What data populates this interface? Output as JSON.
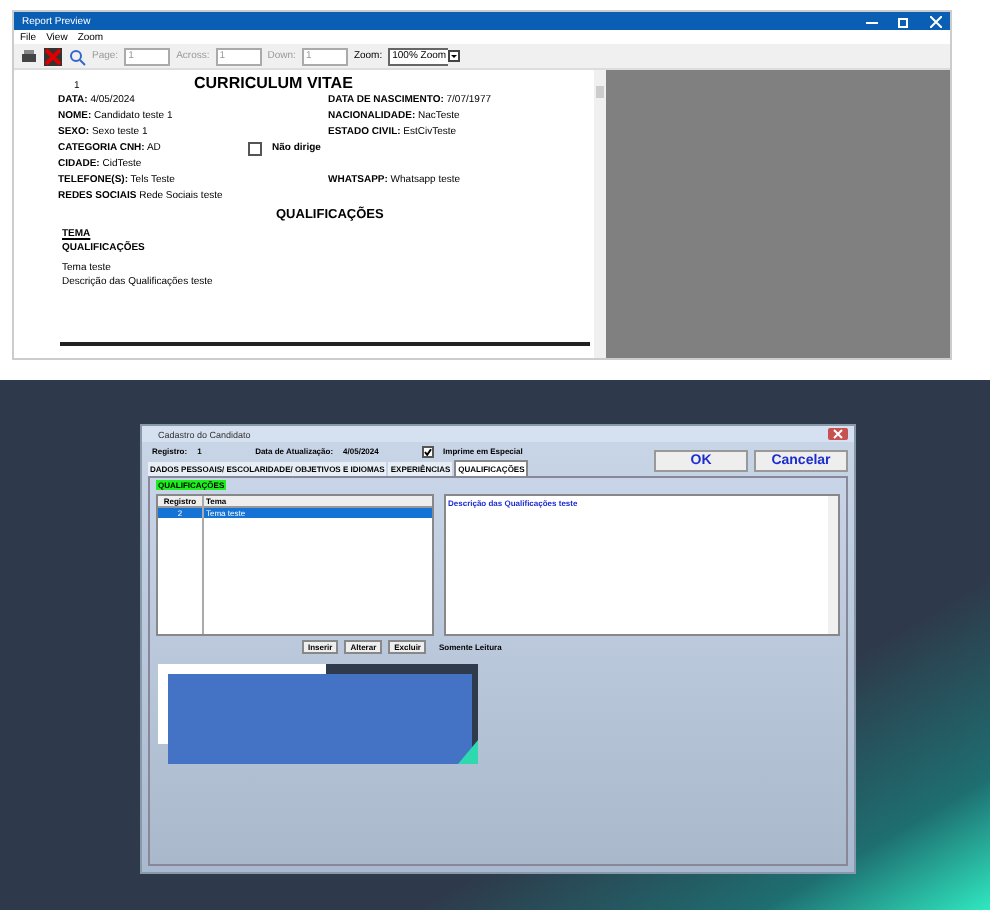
{
  "preview": {
    "title": "Report Preview",
    "menu": [
      "File",
      "View",
      "Zoom"
    ],
    "toolbar": {
      "page_label": "Page:",
      "page": "1",
      "across_label": "Across:",
      "across": "1",
      "down_label": "Down:",
      "down": "1",
      "zoom_label": "Zoom:",
      "zoom": "100% Zoom"
    },
    "report": {
      "page_number": "1",
      "title": "CURRICULUM VITAE",
      "rows": [
        {
          "kind": "pair",
          "left": {
            "label": "DATA:",
            "value": "4/05/2024"
          },
          "right": {
            "label": "DATA DE NASCIMENTO:",
            "value": "7/07/1977"
          }
        },
        {
          "kind": "pair",
          "left": {
            "label": "NOME:",
            "value": "Candidato teste 1"
          },
          "right": {
            "label": "NACIONALIDADE:",
            "value": "NacTeste"
          }
        },
        {
          "kind": "pair",
          "left": {
            "label": "SEXO:",
            "value": "Sexo teste 1"
          },
          "right": {
            "label": "ESTADO CIVIL:",
            "value": "EstCivTeste"
          }
        },
        {
          "kind": "check",
          "left": {
            "label": "CATEGORIA CNH:",
            "value": "AD"
          },
          "check": {
            "label": "Não dirige",
            "checked": false
          }
        },
        {
          "kind": "pair",
          "left": {
            "label": "CIDADE:",
            "value": "CidTeste"
          }
        },
        {
          "kind": "pair",
          "left": {
            "label": "TELEFONE(S):",
            "value": "Tels Teste"
          },
          "right": {
            "label": "WHATSAPP:",
            "value": "Whatsapp teste"
          }
        },
        {
          "kind": "pair",
          "left": {
            "label": "REDES SOCIAIS",
            "value": "Rede Sociais teste"
          }
        }
      ],
      "section": "QUALIFICAÇÕES",
      "heading_1": "TEMA",
      "heading_2": "QUALIFICAÇÕES",
      "lines": [
        "Tema teste",
        "Descrição das Qualificações teste"
      ]
    }
  },
  "dialog": {
    "title": "Cadastro do Candidato",
    "registro_label": "Registro:",
    "registro": "1",
    "date_label": "Data de Atualização:",
    "date": "4/05/2024",
    "print_special": {
      "label": "Imprime em Especial",
      "checked": true
    },
    "buttons": [
      "OK",
      "Cancelar"
    ],
    "tabs": [
      {
        "label": "DADOS PESSOAIS/ ESCOLARIDADE/ OBJETIVOS E IDIOMAS",
        "selected": false
      },
      {
        "label": "EXPERIÊNCIAS",
        "selected": false
      },
      {
        "label": "QUALIFICAÇÕES",
        "selected": true
      }
    ],
    "group_label": "QUALIFICAÇÕES",
    "grid": {
      "columns": [
        "Registro",
        "Tema"
      ],
      "rows": [
        {
          "cells": [
            "2",
            "Tema teste"
          ],
          "selected": true
        }
      ]
    },
    "memo": "Descrição das Qualificações teste",
    "actions": [
      "Inserir",
      "Alterar",
      "Excluir"
    ],
    "readonly_label": "Somente Leitura",
    "image": {
      "kind": "picture"
    }
  }
}
